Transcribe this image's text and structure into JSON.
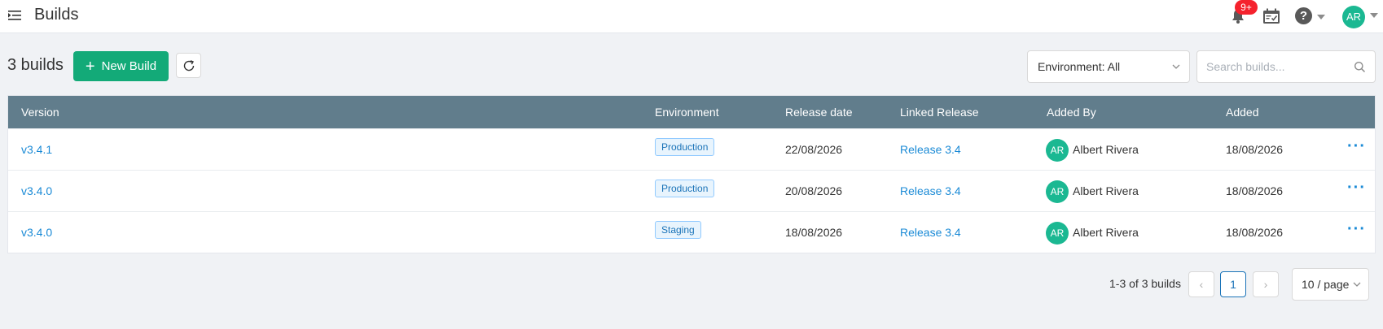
{
  "header": {
    "title": "Builds",
    "notification_badge": "9+",
    "help_glyph": "?",
    "user_initials": "AR"
  },
  "toolbar": {
    "count_label": "3 builds",
    "new_build_label": "New Build",
    "new_build_glyph": "+",
    "environment_filter": "Environment: All",
    "search_placeholder": "Search builds..."
  },
  "table": {
    "columns": [
      "Version",
      "Environment",
      "Release date",
      "Linked Release",
      "Added By",
      "Added"
    ],
    "rows": [
      {
        "version": "v3.4.1",
        "environment": "Production",
        "release_date": "22/08/2026",
        "linked_release": "Release 3.4",
        "added_by_initials": "AR",
        "added_by": "Albert Rivera",
        "added": "18/08/2026",
        "more": "···"
      },
      {
        "version": "v3.4.0",
        "environment": "Production",
        "release_date": "20/08/2026",
        "linked_release": "Release 3.4",
        "added_by_initials": "AR",
        "added_by": "Albert Rivera",
        "added": "18/08/2026",
        "more": "···"
      },
      {
        "version": "v3.4.0",
        "environment": "Staging",
        "release_date": "18/08/2026",
        "linked_release": "Release 3.4",
        "added_by_initials": "AR",
        "added_by": "Albert Rivera",
        "added": "18/08/2026",
        "more": "···"
      }
    ]
  },
  "pagination": {
    "total_label": "1-3 of 3 builds",
    "current_page": "1",
    "prev_glyph": "‹",
    "next_glyph": "›",
    "page_size": "10 / page"
  },
  "colors": {
    "primary": "#13aa78",
    "header_bar": "#617d8c",
    "link": "#1a8ad6",
    "badge": "#f5222d",
    "avatar": "#1bb892"
  },
  "icons": {
    "menu": "menu-fold-icon",
    "bell": "bell-icon",
    "calendar": "calendar-check-icon",
    "help": "question-circle-icon",
    "refresh": "refresh-icon",
    "search": "search-icon",
    "more": "more-horizontal-icon"
  }
}
